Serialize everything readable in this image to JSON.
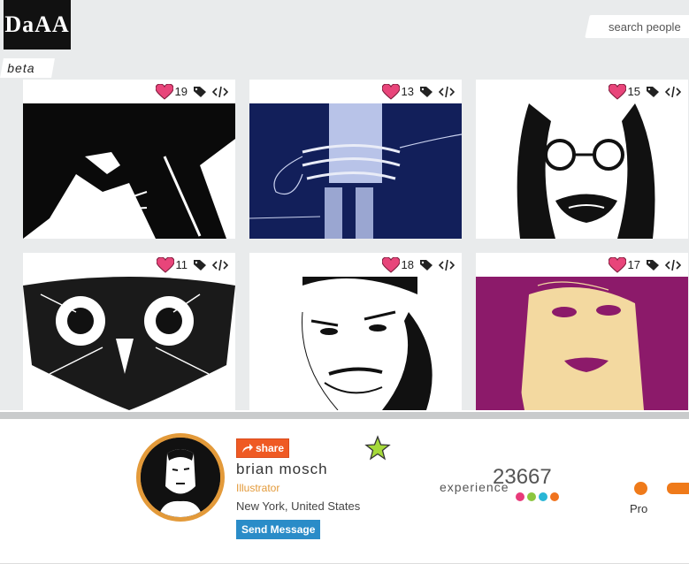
{
  "header": {
    "logo_text": "DaAA",
    "search_placeholder": "search people",
    "beta_label": "beta"
  },
  "gallery": [
    {
      "likes": "19",
      "style": "bw-man-profile"
    },
    {
      "likes": "13",
      "style": "navy-figure-on-chair"
    },
    {
      "likes": "15",
      "style": "bw-man-glasses"
    },
    {
      "likes": "11",
      "style": "bw-owl"
    },
    {
      "likes": "18",
      "style": "bw-man-face"
    },
    {
      "likes": "17",
      "style": "purple-woman-face"
    }
  ],
  "profile": {
    "share_label": "share",
    "name": "brian mosch",
    "role": "Illustrator",
    "location": "New York, United States",
    "send_message_label": "Send Message",
    "experience_label": "experience",
    "experience_value": "23667",
    "level_label": "Pro",
    "dot_colors": [
      "#e83a7a",
      "#8cc63f",
      "#29b6d6",
      "#f0731e"
    ]
  },
  "colors": {
    "accent": "#ef5a24",
    "role": "#e39a3a",
    "button": "#2a8cc8",
    "heart": "#e8457a"
  }
}
